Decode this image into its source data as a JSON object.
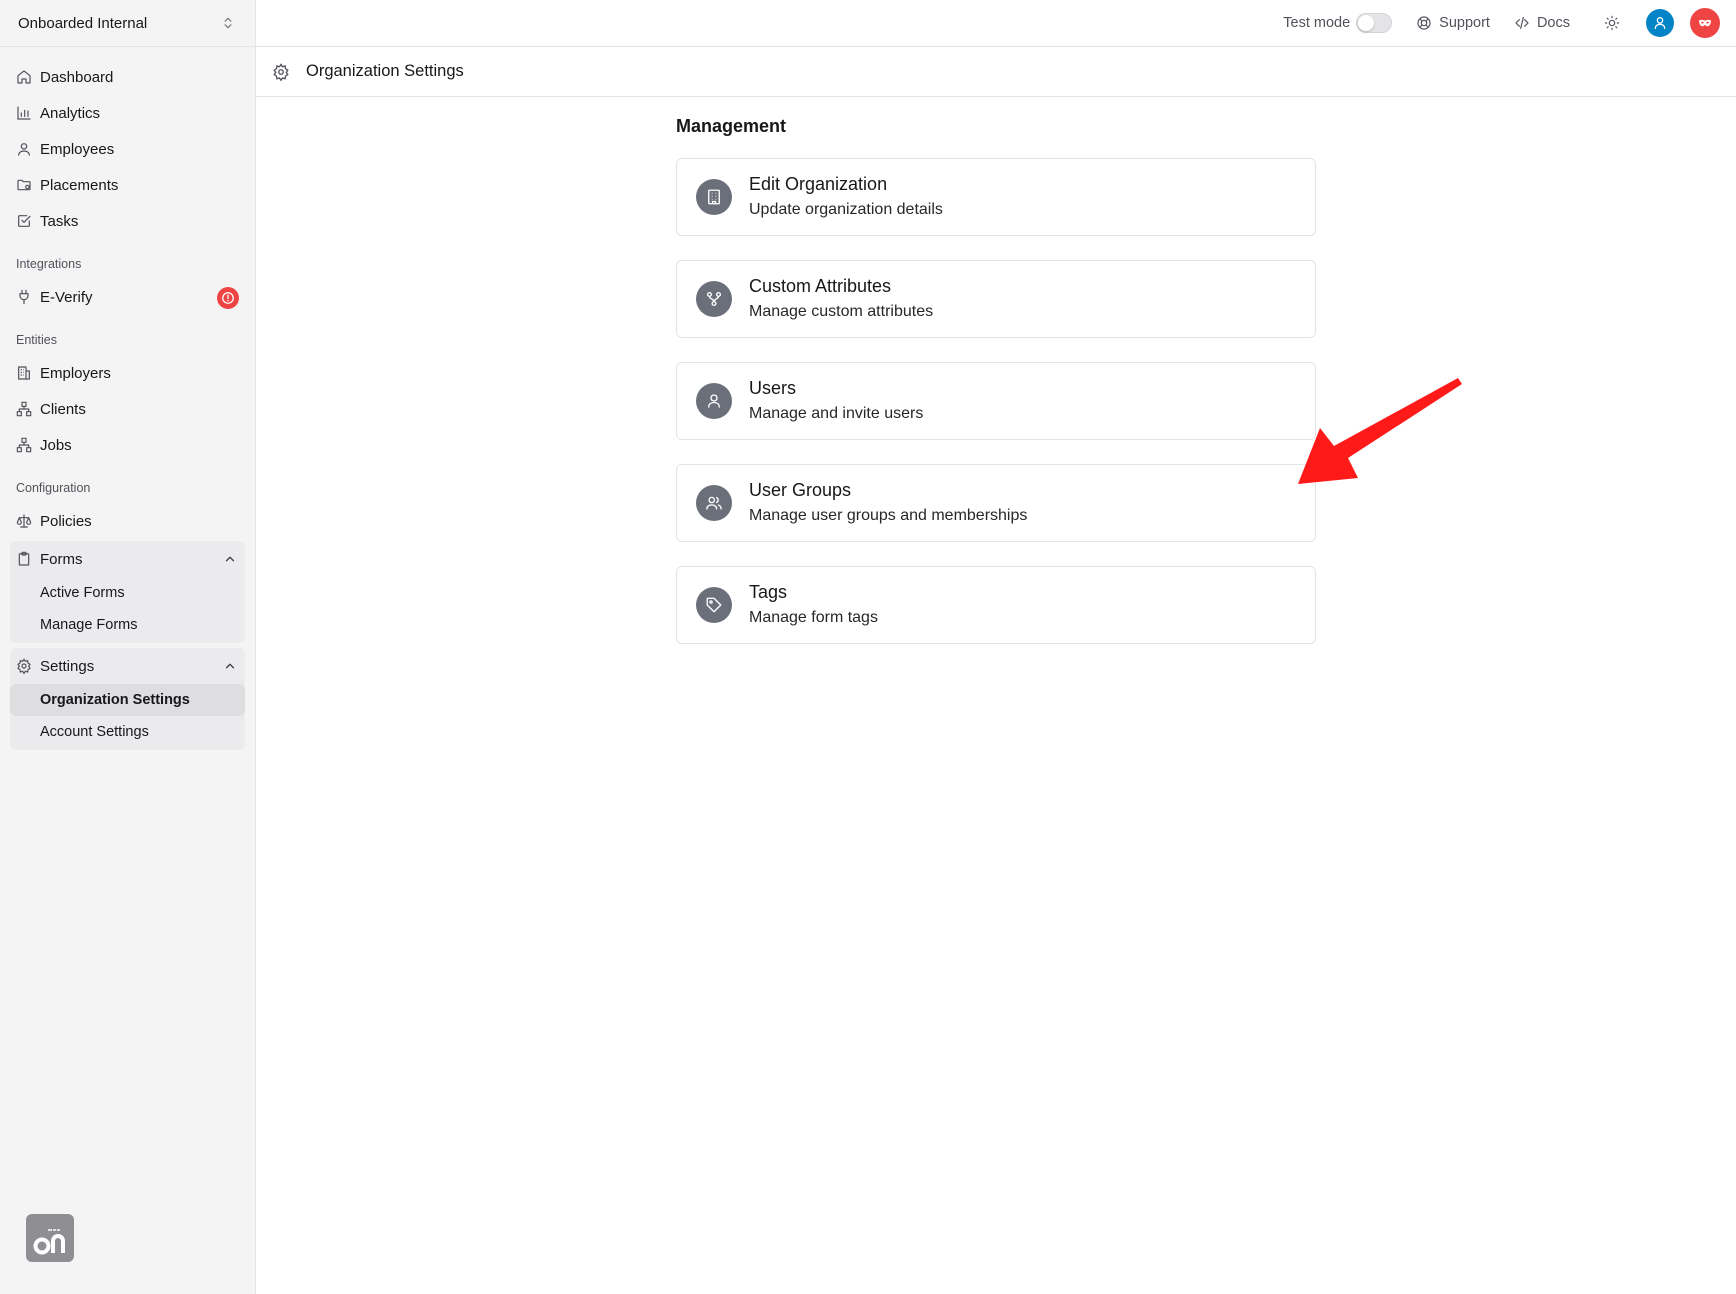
{
  "sidebar": {
    "org_name": "Onboarded Internal",
    "primary": [
      {
        "label": "Dashboard",
        "icon": "home-icon"
      },
      {
        "label": "Analytics",
        "icon": "bar-chart-icon"
      },
      {
        "label": "Employees",
        "icon": "user-icon"
      },
      {
        "label": "Placements",
        "icon": "folder-icon"
      },
      {
        "label": "Tasks",
        "icon": "checkbox-icon"
      }
    ],
    "integrations_label": "Integrations",
    "everify_label": "E-Verify",
    "entities_label": "Entities",
    "entities": [
      {
        "label": "Employers"
      },
      {
        "label": "Clients"
      },
      {
        "label": "Jobs"
      }
    ],
    "configuration_label": "Configuration",
    "policies_label": "Policies",
    "forms": {
      "label": "Forms",
      "items": [
        "Active Forms",
        "Manage Forms"
      ]
    },
    "settings": {
      "label": "Settings",
      "items": [
        "Organization Settings",
        "Account Settings"
      ],
      "active": "Organization Settings"
    }
  },
  "topbar": {
    "test_mode_label": "Test mode",
    "support_label": "Support",
    "docs_label": "Docs"
  },
  "page": {
    "title": "Organization Settings"
  },
  "management": {
    "title": "Management",
    "cards": [
      {
        "title": "Edit Organization",
        "description": "Update organization details",
        "icon": "building-icon"
      },
      {
        "title": "Custom Attributes",
        "description": "Manage custom attributes",
        "icon": "branch-icon"
      },
      {
        "title": "Users",
        "description": "Manage and invite users",
        "icon": "user-icon"
      },
      {
        "title": "User Groups",
        "description": "Manage user groups and memberships",
        "icon": "users-icon"
      },
      {
        "title": "Tags",
        "description": "Manage form tags",
        "icon": "tag-icon"
      }
    ]
  },
  "colors": {
    "sidebar_bg": "#f4f4f5",
    "alert_red": "#ef4444",
    "avatar_blue": "#0284c7",
    "avatar_red": "#ef4444",
    "card_icon_bg": "#6b6f7a",
    "annotation_arrow": "#ff1a1a"
  }
}
